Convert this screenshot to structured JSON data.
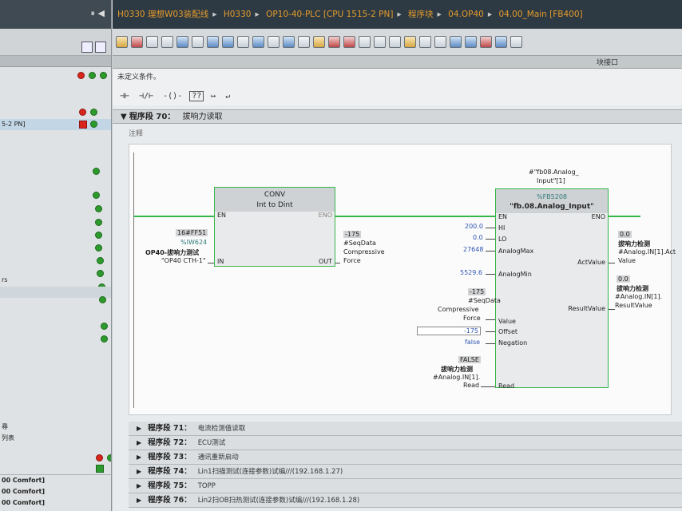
{
  "project_tree": {
    "rows": [
      {
        "label": "",
        "status": "red-green"
      },
      {
        "label": "",
        "status": "red-green"
      },
      {
        "label": "5-2 PN]",
        "status": "red-green",
        "selected": true
      },
      {
        "label": "",
        "status": "green"
      },
      {
        "label": "",
        "status": "green"
      },
      {
        "label": "rs",
        "status": "green"
      },
      {
        "label": "",
        "status": "green"
      },
      {
        "label": "",
        "status": "green"
      }
    ],
    "bottom_items": [
      "尋",
      "列表",
      "",
      "00 Comfort]",
      "00 Comfort]",
      "00 Comfort]",
      "00 Comfort]"
    ]
  },
  "breadcrumb": [
    "H0330 理想W03装配线",
    "H0330",
    "OP10-40-PLC [CPU 1515-2 PN]",
    "程序块",
    "04.OP40",
    "04.00_Main [FB400]"
  ],
  "subbar_label": "块接口",
  "condition_text": "未定义条件。",
  "ladder_toolbar": [
    "⊣⊢",
    "⊣/⊢",
    "-()-",
    "??",
    "↦",
    "↵"
  ],
  "network70": {
    "label": "程序段 70：",
    "title": "拔响力读取",
    "comment": "注释",
    "conv": {
      "name": "CONV",
      "types": "Int  to  Dint",
      "pins": {
        "en": "EN",
        "eno": "ENO",
        "in": "IN",
        "out": "OUT"
      },
      "in_value": "16#FF51",
      "in_addr": "%IW624",
      "in_tag": "OP40-拔响力测试",
      "in_comment": "\"OP40 CTH-1\"",
      "out_value": "-175",
      "out_var": "#SeqData",
      "out_var2": "Compressive",
      "out_var3": "Force"
    },
    "fb": {
      "instance1": "#\"fb08.Analog_",
      "instance2": "Input\"[1]",
      "number": "%FB5208",
      "name": "\"fb.08.Analog_Input\"",
      "pins_left": [
        "EN",
        "HI",
        "LO",
        "AnalogMax",
        "AnalogMin",
        "Value",
        "Offset",
        "Negation",
        "Read"
      ],
      "pins_right": [
        "ENO",
        "ActValue",
        "ResultValue"
      ],
      "hi": "200.0",
      "lo": "0.0",
      "analog_max": "27648",
      "analog_min": "5529.6",
      "value_val": "-175",
      "value_var1": "#SeqData",
      "value_var2": "Compressive",
      "value_var3": "Force",
      "offset_val": "-175",
      "negation_val": "false",
      "read_val": "FALSE",
      "read_tag": "拔响力检测",
      "read_var1": "#Analog.IN[1].",
      "read_var2": "Read",
      "act_val": "0.0",
      "act_tag": "拔响力检测",
      "act_var1": "#Analog.IN[1].Act",
      "act_var2": "Value",
      "res_val": "0.0",
      "res_tag": "拔响力检测",
      "res_var1": "#Analog.IN[1].",
      "res_var2": "ResultValue"
    }
  },
  "networks": [
    {
      "label": "程序段 71：",
      "comment": "电流检测值读取"
    },
    {
      "label": "程序段 72：",
      "comment": "ECU测试"
    },
    {
      "label": "程序段 73：",
      "comment": "通讯重新启动"
    },
    {
      "label": "程序段 74：",
      "comment": "Lin1扫描测试(连接参数)试编///(192.168.1.27)"
    },
    {
      "label": "程序段 75：",
      "comment": "TOPP"
    },
    {
      "label": "程序段 76：",
      "comment": "Lin2扫OB扫热测试(连接参数)试编///(192.168.1.28)"
    }
  ]
}
